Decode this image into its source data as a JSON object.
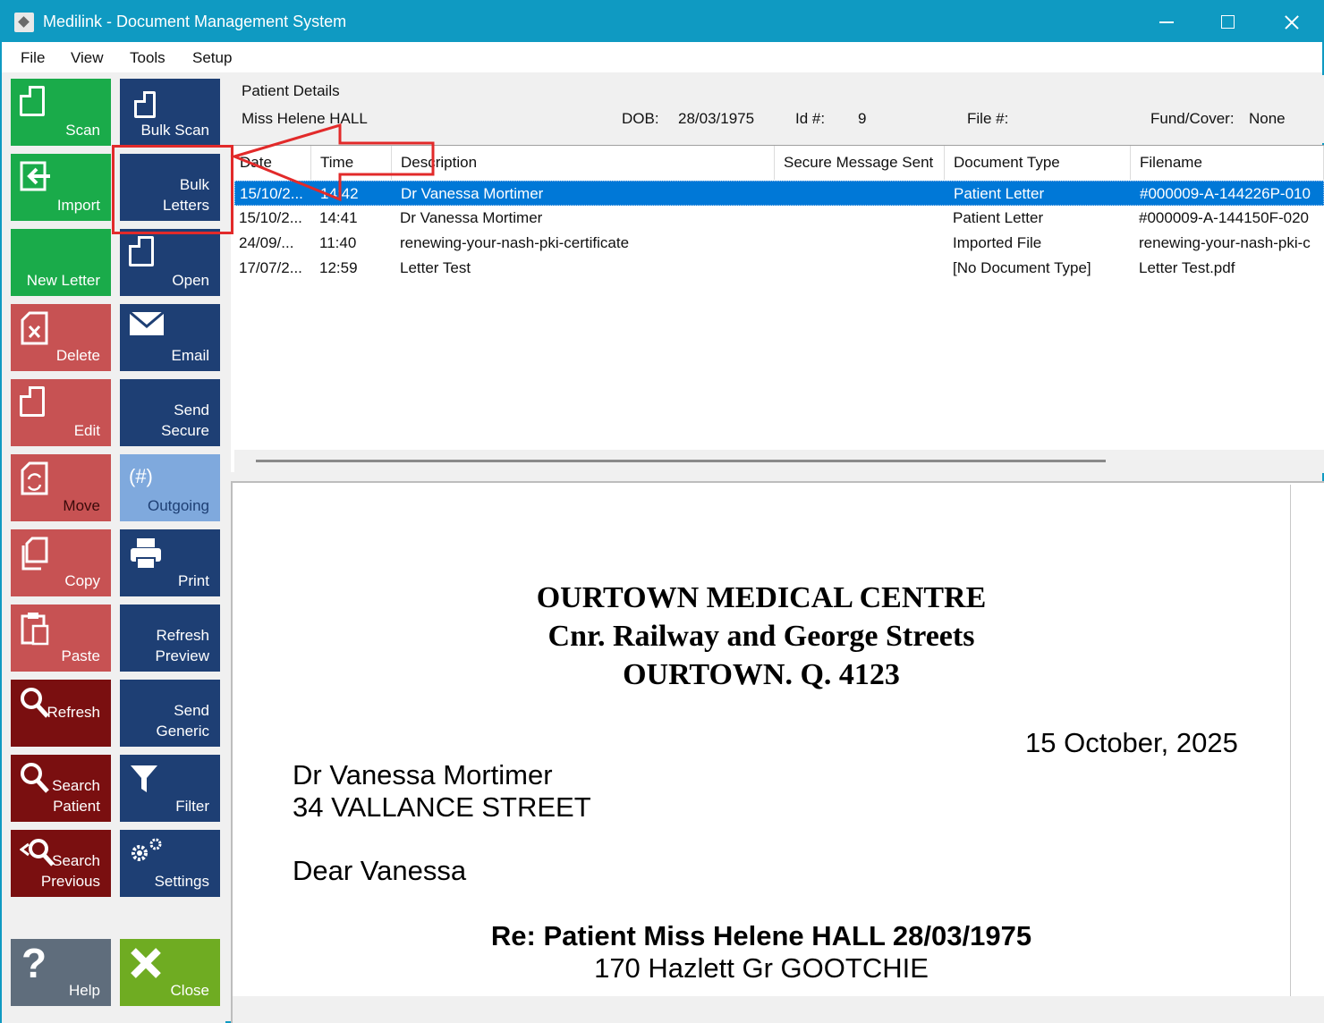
{
  "window": {
    "title": "Medilink - Document Management System"
  },
  "menu": [
    "File",
    "View",
    "Tools",
    "Setup"
  ],
  "toolbar": {
    "scan": "Scan",
    "bulk_scan": "Bulk Scan",
    "import": "Import",
    "bulk_letters_1": "Bulk",
    "bulk_letters_2": "Letters",
    "new_letter": "New Letter",
    "open": "Open",
    "delete": "Delete",
    "email": "Email",
    "edit": "Edit",
    "send_secure_1": "Send",
    "send_secure_2": "Secure",
    "move": "Move",
    "outgoing_badge": "(#)",
    "outgoing": "Outgoing",
    "copy": "Copy",
    "print": "Print",
    "paste": "Paste",
    "refresh_preview_1": "Refresh",
    "refresh_preview_2": "Preview",
    "refresh": "Refresh",
    "send_generic_1": "Send",
    "send_generic_2": "Generic",
    "search_patient_1": "Search",
    "search_patient_2": "Patient",
    "filter": "Filter",
    "search_previous_1": "Search",
    "search_previous_2": "Previous",
    "settings": "Settings",
    "help": "Help",
    "close": "Close"
  },
  "patient": {
    "section_title": "Patient Details",
    "name": "Miss Helene HALL",
    "dob_label": "DOB:",
    "dob": "28/03/1975",
    "id_label": "Id #:",
    "id": "9",
    "file_label": "File #:",
    "fund_label": "Fund/Cover:",
    "fund": "None"
  },
  "grid": {
    "columns": [
      "Date",
      "Time",
      "Description",
      "Secure Message Sent",
      "Document Type",
      "Filename"
    ],
    "rows": [
      {
        "date": "15/10/2...",
        "time": "14:42",
        "description": "Dr Vanessa Mortimer",
        "secure": "",
        "doctype": "Patient Letter",
        "filename": "#000009-A-144226P-010"
      },
      {
        "date": "15/10/2...",
        "time": "14:41",
        "description": "Dr Vanessa Mortimer",
        "secure": "",
        "doctype": "Patient Letter",
        "filename": "#000009-A-144150F-020"
      },
      {
        "date": "24/09/...",
        "time": "11:40",
        "description": "renewing-your-nash-pki-certificate",
        "secure": "",
        "doctype": "Imported File",
        "filename": "renewing-your-nash-pki-c"
      },
      {
        "date": "17/07/2...",
        "time": "12:59",
        "description": "Letter Test",
        "secure": "",
        "doctype": "[No Document Type]",
        "filename": "Letter Test.pdf"
      }
    ]
  },
  "letter": {
    "head_1": "OURTOWN MEDICAL CENTRE",
    "head_2": "Cnr. Railway and George Streets",
    "head_3": "OURTOWN. Q. 4123",
    "date": "15 October, 2025",
    "recipient": "Dr Vanessa Mortimer",
    "address": "34 VALLANCE STREET",
    "greeting": "Dear Vanessa",
    "re_line": "Re: Patient Miss Helene HALL 28/03/1975",
    "re_address": "170 Hazlett Gr GOOTCHIE"
  },
  "colors": {
    "titlebar": "#0f9ac2",
    "green": "#1aab4a",
    "navy": "#1e3f74",
    "red": "#c75253",
    "dark_red": "#7a0f10",
    "selection": "#0078d7",
    "annotation": "#e22a2a"
  }
}
